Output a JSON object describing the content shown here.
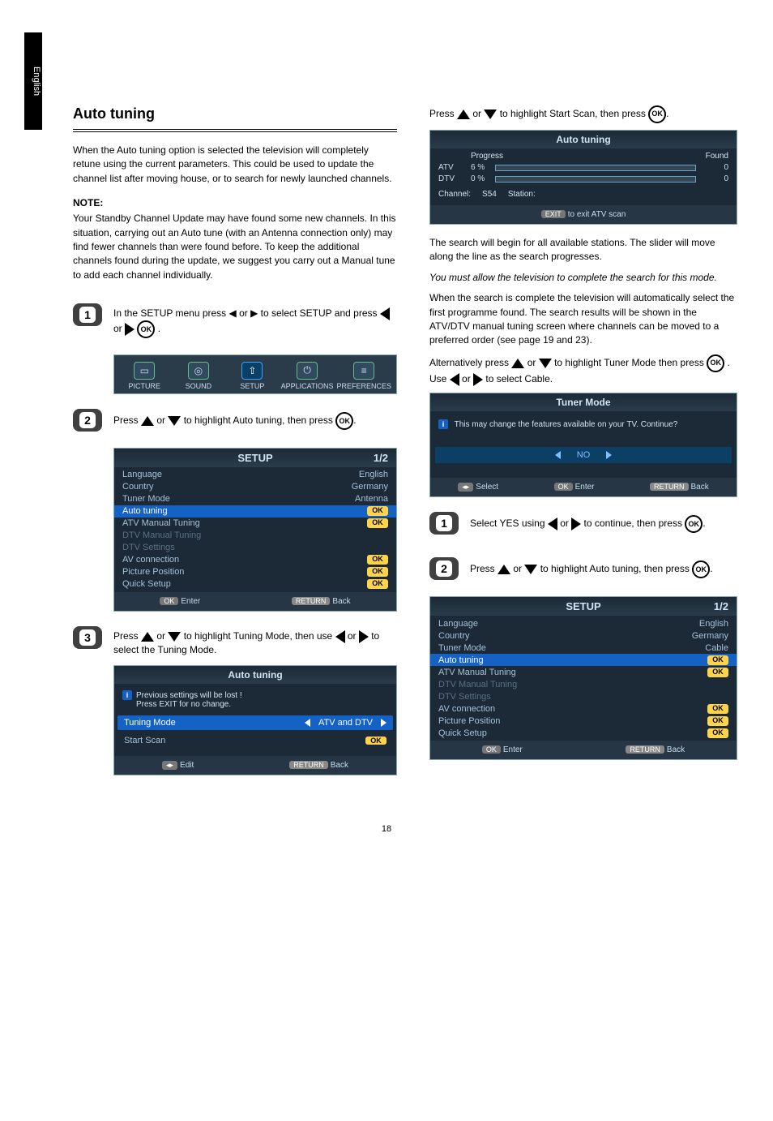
{
  "sidebar_label": "English",
  "left": {
    "heading": "Auto tuning",
    "p1": "When the Auto tuning option is selected the television will completely retune using the current parameters.  This could be used to update the channel list after moving house, or to search for newly launched channels.",
    "note_label": "NOTE:",
    "p2_note": "Your Standby Channel Update may have found some new channels. In this situation, carrying out an Auto tune (with an Antenna connection only) may find fewer channels than were found before. To keep the additional channels found during the update, we suggest you carry out a Manual tune to add each channel individually.",
    "step1": "In the SETUP menu press ◀ or ▶ to select SETUP and press",
    "step2_a": "Press ",
    "step2_b": " or ",
    "step2_c": " to highlight Auto tuning, then press ",
    "step3_a": "Press ",
    "step3_b": " or ",
    "step3_c": " to highlight Tuning Mode, then use ",
    "step3_d": " or ",
    "step3_e": " to select the Tuning Mode.",
    "setup_panel": {
      "tabs": [
        "PICTURE",
        "SOUND",
        "SETUP",
        "APPLICATIONS",
        "PREFERENCES"
      ],
      "title": "SETUP",
      "page": "1/2",
      "rows": [
        {
          "label": "Language",
          "val": "English"
        },
        {
          "label": "Country",
          "val": "Germany"
        },
        {
          "label": "Tuner Mode",
          "val": "Antenna"
        },
        {
          "label": "Auto tuning",
          "val": "OK",
          "sel": true
        },
        {
          "label": "ATV Manual Tuning",
          "val": "OK"
        },
        {
          "label": "DTV Manual Tuning",
          "val": "",
          "disabled": true
        },
        {
          "label": "DTV Settings",
          "val": "",
          "disabled": true
        },
        {
          "label": "AV connection",
          "val": "OK"
        },
        {
          "label": "Picture Position",
          "val": "OK"
        },
        {
          "label": "Quick Setup",
          "val": "OK"
        }
      ],
      "footer_enter": "Enter",
      "footer_back": "Back"
    },
    "autotune_warn": {
      "title": "Auto tuning",
      "warn1": "Previous settings will be lost !",
      "warn2": "Press EXIT for no change.",
      "tuning_mode_label": "Tuning Mode",
      "tuning_mode_val": "ATV and DTV",
      "start_label": "Start Scan",
      "start_val": "OK",
      "footer_edit": "Edit",
      "footer_back": "Back"
    }
  },
  "right": {
    "p1_a": "Press ",
    "p1_b": " or ",
    "p1_c": " to highlight Start Scan, then press ",
    "progress_title": "Auto tuning",
    "prog_head_progress": "Progress",
    "prog_head_found": "Found",
    "rows": [
      {
        "label": "ATV",
        "pct": "6  %",
        "fill": 6,
        "found": "0"
      },
      {
        "label": "DTV",
        "pct": "0  %",
        "fill": 0,
        "found": "0"
      }
    ],
    "channel_label": "Channel:",
    "channel_val": "S54",
    "station_label": "Station:",
    "exit_hint": "to exit ATV scan",
    "exit_chip": "EXIT",
    "p2": "The search will begin for all available stations. The slider will move along the line as the search progresses.",
    "p3_bold": "You must allow the television to complete the search for this mode.",
    "p4": "When the search is complete the television will automatically select the first programme found. The search results will be shown in the ATV/DTV manual tuning screen where channels can be moved to a preferred order (see page 19 and 23).",
    "p5_a": "Alternatively press ",
    "p5_b": " or ",
    "p5_c": " to highlight Tuner Mode then press ",
    "p5_d": " . Use ",
    "p5_e": " or ",
    "p5_f": " to select Cable.",
    "tuner_title": "Tuner Mode",
    "tuner_warn": "This may change the features available on your TV. Continue?",
    "tuner_no": "NO",
    "tuner_footer_select": "Select",
    "tuner_footer_enter": "Enter",
    "tuner_footer_back": "Back",
    "r_step1_a": "Select YES using ",
    "r_step1_b": " or ",
    "r_step1_c": " to continue, then press ",
    "r_step2_a": "Press ",
    "r_step2_b": " or ",
    "r_step2_c": " to highlight Auto tuning, then press ",
    "setup_panel2": {
      "title": "SETUP",
      "page": "1/2",
      "rows": [
        {
          "label": "Language",
          "val": "English"
        },
        {
          "label": "Country",
          "val": "Germany"
        },
        {
          "label": "Tuner Mode",
          "val": "Cable"
        },
        {
          "label": "Auto tuning",
          "val": "OK",
          "sel": true
        },
        {
          "label": "ATV Manual Tuning",
          "val": "OK"
        },
        {
          "label": "DTV Manual Tuning",
          "val": "",
          "disabled": true
        },
        {
          "label": "DTV Settings",
          "val": "",
          "disabled": true
        },
        {
          "label": "AV connection",
          "val": "OK"
        },
        {
          "label": "Picture Position",
          "val": "OK"
        },
        {
          "label": "Quick Setup",
          "val": "OK"
        }
      ],
      "footer_enter": "Enter",
      "footer_back": "Back"
    }
  },
  "labels": {
    "ok": "OK",
    "return": "RETURN"
  },
  "page_num": "18"
}
